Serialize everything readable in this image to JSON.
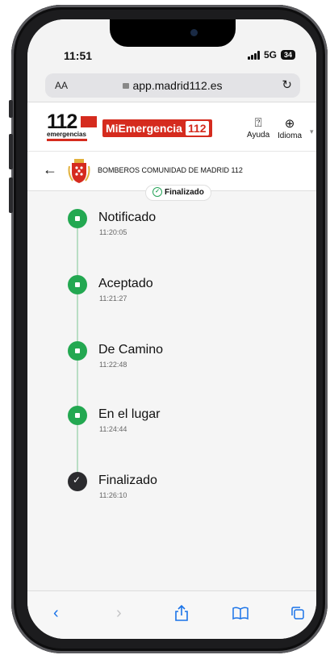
{
  "status": {
    "time": "11:51",
    "network": "5G",
    "battery": "34"
  },
  "browser": {
    "aa": "AA",
    "url": "app.madrid112.es"
  },
  "header": {
    "logo_number": "112",
    "logo_text": "emergencias",
    "brand": "MiEmergencia",
    "brand_number": "112",
    "help_label": "Ayuda",
    "language_label": "Idioma"
  },
  "service": {
    "name": "BOMBEROS COMUNIDAD DE MADRID 112"
  },
  "badge": {
    "label": "Finalizado"
  },
  "steps": [
    {
      "label": "Notificado",
      "time": "11:20:05"
    },
    {
      "label": "Aceptado",
      "time": "11:21:27"
    },
    {
      "label": "De Camino",
      "time": "11:22:48"
    },
    {
      "label": "En el lugar",
      "time": "11:24:44"
    },
    {
      "label": "Finalizado",
      "time": "11:26:10"
    }
  ],
  "colors": {
    "brand_red": "#d52b1e",
    "step_green": "#23a851",
    "step_done": "#2b2b2e",
    "ios_blue": "#1a73e8"
  },
  "icons": [
    "help-icon",
    "globe-icon",
    "back-arrow-icon",
    "share-icon",
    "bookmarks-icon",
    "tabs-icon"
  ]
}
